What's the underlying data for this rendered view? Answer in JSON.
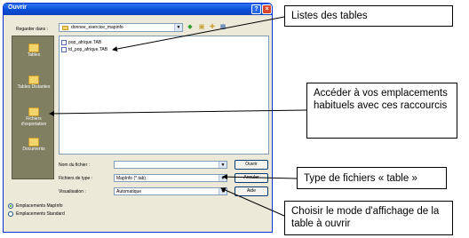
{
  "dialog": {
    "title": "Ouvrir",
    "help_button": "?",
    "close_button": "×",
    "look_in_label": "Regarder dans :",
    "look_in_value": "donnee_exercice_mapinfo",
    "places": [
      {
        "label": "Tables"
      },
      {
        "label": "Tables Distantes"
      },
      {
        "label": "Fichiers d'exportation"
      },
      {
        "label": "Documents"
      }
    ],
    "files": [
      {
        "name": "pop_afrique.TAB"
      },
      {
        "name": "td_pop_afrique.TAB"
      }
    ],
    "file_name_label": "Nom du fichier :",
    "file_name_value": "",
    "file_type_label": "Fichiers de type :",
    "file_type_value": "MapInfo (*.tab)",
    "view_label": "Visualisation :",
    "view_value": "Automatique",
    "open_button": "Ouvrir",
    "cancel_button": "Annuler",
    "help_text_button": "Aide",
    "radio_mapinfo": "Emplacements MapInfo",
    "radio_standard": "Emplacements Standard"
  },
  "callouts": {
    "tables_list": "Listes des tables",
    "shortcuts": "Accéder à vos emplacements habituels avec ces raccourcis",
    "file_type": "Type de fichiers « table »",
    "display_mode": "Choisir le mode d'affichage de la table à ouvrir"
  },
  "colors": {
    "titlebar": "#0a4fd8",
    "places_bar": "#807f62",
    "dialog_bg": "#ece9d8"
  }
}
